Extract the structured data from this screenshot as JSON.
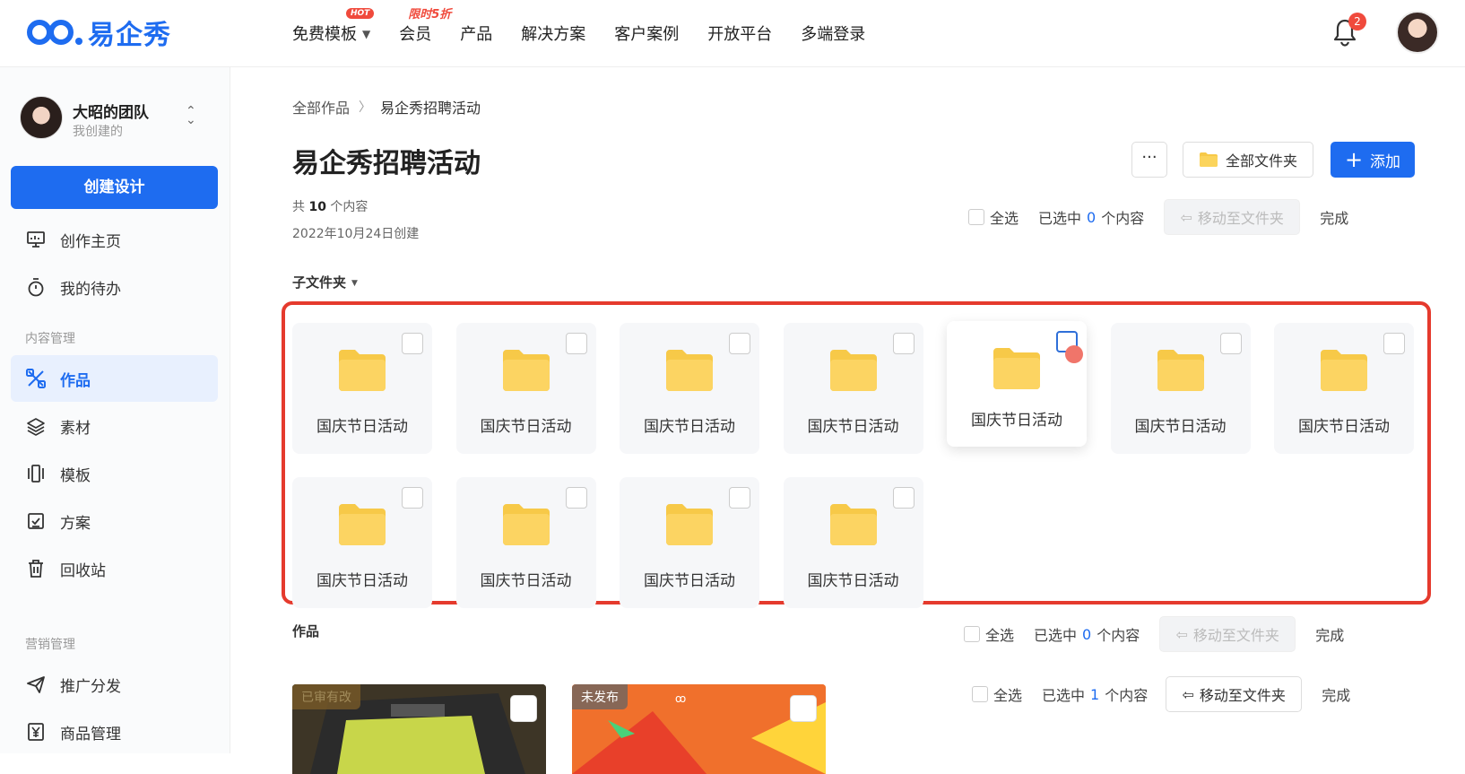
{
  "brand": {
    "name": "易企秀"
  },
  "nav": {
    "items": [
      "免费模板",
      "会员",
      "产品",
      "解决方案",
      "客户案例",
      "开放平台",
      "多端登录"
    ],
    "hot_badge": "HOT",
    "promo_label": "限时5折"
  },
  "notifications": {
    "count": "2"
  },
  "sidebar": {
    "team_name": "大昭的团队",
    "team_sub": "我创建的",
    "create_button": "创建设计",
    "items_top": [
      "创作主页",
      "我的待办"
    ],
    "section_content": "内容管理",
    "items_content": [
      "作品",
      "素材",
      "模板",
      "方案",
      "回收站"
    ],
    "section_marketing": "营销管理",
    "items_marketing": [
      "推广分发",
      "商品管理"
    ]
  },
  "breadcrumb": {
    "root": "全部作品",
    "current": "易企秀招聘活动"
  },
  "page": {
    "title": "易企秀招聘活动",
    "count_prefix": "共",
    "count": "10",
    "count_suffix": "个内容",
    "created": "2022年10月24日创建",
    "more_button": "···",
    "all_folders_button": "全部文件夹",
    "add_button": "添加"
  },
  "selection": {
    "select_all": "全选",
    "selected_prefix": "已选中",
    "selected_suffix": "个内容",
    "move_button": "移动至文件夹",
    "done": "完成",
    "rows": [
      {
        "count": "0"
      },
      {
        "count": "0"
      },
      {
        "count": "1"
      }
    ]
  },
  "subfolders": {
    "heading": "子文件夹",
    "items": [
      "国庆节日活动",
      "国庆节日活动",
      "国庆节日活动",
      "国庆节日活动",
      "国庆节日活动",
      "国庆节日活动",
      "国庆节日活动",
      "国庆节日活动",
      "国庆节日活动",
      "国庆节日活动",
      "国庆节日活动"
    ]
  },
  "works": {
    "heading": "作品",
    "items": [
      {
        "tag": "已审有改"
      },
      {
        "tag": "未发布"
      }
    ]
  },
  "colors": {
    "accent": "#1e6cf0",
    "highlight_box": "#e53a2d",
    "folder": "#f7c948"
  }
}
